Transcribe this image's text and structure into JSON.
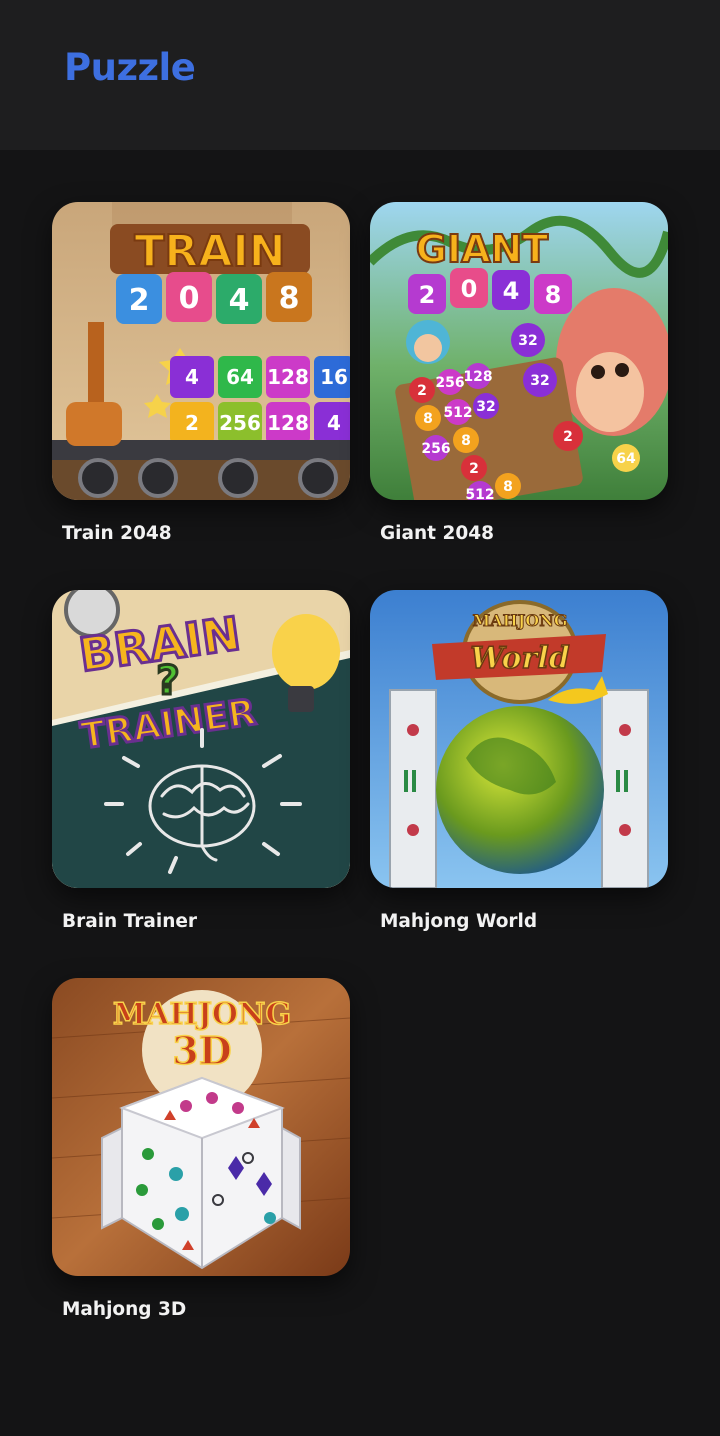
{
  "header": {
    "title": "Puzzle"
  },
  "theme": {
    "accent": "#3d6fe0",
    "background": "#141415",
    "header_background": "#1e1e1f"
  },
  "games": [
    {
      "name": "Train 2048",
      "art": {
        "title": "TRAIN",
        "subtitle_tiles": [
          "2",
          "0",
          "4",
          "8"
        ],
        "tiles": [
          "4",
          "64",
          "128",
          "16",
          "2",
          "256",
          "128",
          "4"
        ]
      }
    },
    {
      "name": "Giant 2048",
      "art": {
        "title": "GIANT",
        "subtitle_tiles": [
          "2",
          "0",
          "4",
          "8"
        ],
        "tiles": [
          "32",
          "32",
          "2",
          "256",
          "128",
          "8",
          "512",
          "32",
          "256",
          "8",
          "2",
          "512",
          "8",
          "2",
          "64"
        ]
      }
    },
    {
      "name": "Brain Trainer",
      "art": {
        "title_line1": "BRAIN",
        "question_mark": "?",
        "title_line2": "TRAINER"
      }
    },
    {
      "name": "Mahjong World",
      "art": {
        "title_line1": "MAHJONG",
        "title_line2": "World"
      }
    },
    {
      "name": "Mahjong 3D",
      "art": {
        "title_line1": "MAHJONG",
        "title_line2": "3D"
      }
    }
  ]
}
